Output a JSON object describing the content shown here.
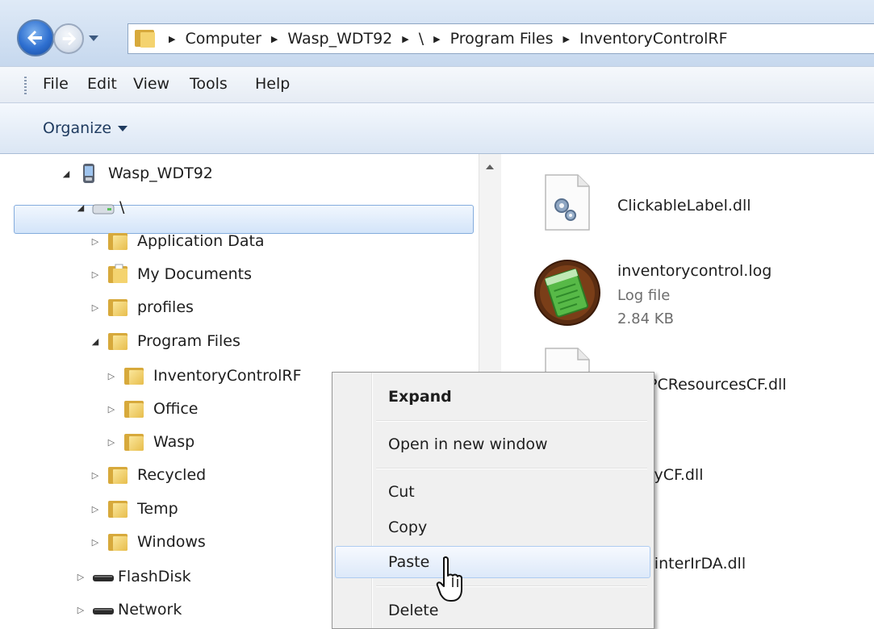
{
  "address": {
    "crumbs": [
      "Computer",
      "Wasp_WDT92",
      "\\",
      "Program Files",
      "InventoryControlRF"
    ]
  },
  "menu": {
    "file": "File",
    "edit": "Edit",
    "view": "View",
    "tools": "Tools",
    "help": "Help"
  },
  "toolbar": {
    "organize": "Organize"
  },
  "tree": {
    "device": "Wasp_WDT92",
    "root": "\\",
    "application_data": "Application Data",
    "my_documents": "My Documents",
    "profiles": "profiles",
    "program_files": "Program Files",
    "inventory_control_rf": "InventoryControlRF",
    "office": "Office",
    "wasp": "Wasp",
    "recycled": "Recycled",
    "temp": "Temp",
    "windows": "Windows",
    "flashdisk": "FlashDisk",
    "network": "Network"
  },
  "files": {
    "f1": {
      "name": "ClickableLabel.dll"
    },
    "f2": {
      "name": "inventorycontrol.log",
      "type": "Log file",
      "size": "2.84 KB"
    },
    "f3": {
      "name": "PCResourcesCF.dll"
    },
    "f4": {
      "name": "tyCF.dll"
    },
    "f5": {
      "name": "rinterIrDA.dll"
    }
  },
  "context_menu": {
    "expand": "Expand",
    "open_new_window": "Open in new window",
    "cut": "Cut",
    "copy": "Copy",
    "paste": "Paste",
    "delete": "Delete"
  },
  "colors": {
    "selection": "#d3e4f9",
    "selection_border": "#84acdd",
    "menu_bg": "#f0f0f0"
  }
}
